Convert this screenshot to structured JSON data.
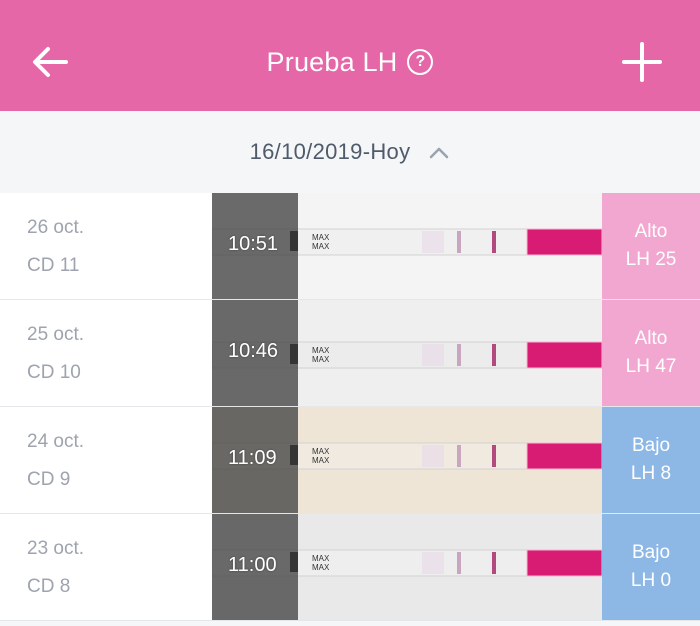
{
  "header": {
    "title": "Prueba LH",
    "help_symbol": "?",
    "background_color": "#e567a8"
  },
  "date_range": {
    "label": "16/10/2019-Hoy",
    "chevron_icon": "chevron-up-icon"
  },
  "entries": [
    {
      "date": "26 oct.",
      "cycle_day": "CD 11",
      "time": "10:51",
      "result": "Alto",
      "lh_value": "LH 25",
      "result_color": "#f2a7d1",
      "paper_color": "#f4f4f4",
      "strip_tint": "#f0f0f0"
    },
    {
      "date": "25 oct.",
      "cycle_day": "CD 10",
      "time": "10:46",
      "result": "Alto",
      "lh_value": "LH 47",
      "result_color": "#f2a7d1",
      "paper_color": "#efefef",
      "strip_tint": "#ececec"
    },
    {
      "date": "24 oct.",
      "cycle_day": "CD 9",
      "time": "11:09",
      "result": "Bajo",
      "lh_value": "LH 8",
      "result_color": "#8db8e6",
      "paper_color": "#efe5d6",
      "strip_tint": "#f1eae0"
    },
    {
      "date": "23 oct.",
      "cycle_day": "CD 8",
      "time": "11:00",
      "result": "Bajo",
      "lh_value": "LH 0",
      "result_color": "#8db8e6",
      "paper_color": "#e9e9e9",
      "strip_tint": "#eeeeee"
    }
  ],
  "strip_label": "MAX"
}
